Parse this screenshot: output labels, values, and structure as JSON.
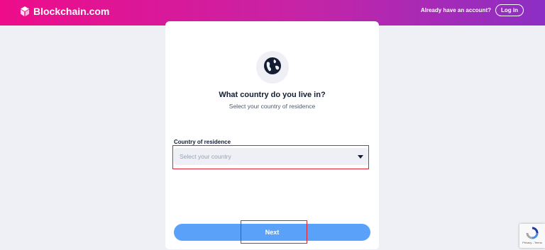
{
  "header": {
    "brand": "Blockchain.com",
    "account_prompt": "Already have an account?",
    "login_label": "Log in"
  },
  "main": {
    "icon": "globe-icon",
    "title": "What country do you live in?",
    "subtitle": "Select your country of residence",
    "country_field": {
      "label": "Country of residence",
      "placeholder": "Select your country",
      "value": ""
    },
    "next_label": "Next"
  },
  "recaptcha": {
    "links": "Privacy - Terms"
  },
  "colors": {
    "header_gradient_start": "#ee0c8a",
    "header_gradient_end": "#8c2fc4",
    "primary_button": "#5aa2f9",
    "highlight": "#e0212f",
    "text_dark": "#121d33"
  }
}
